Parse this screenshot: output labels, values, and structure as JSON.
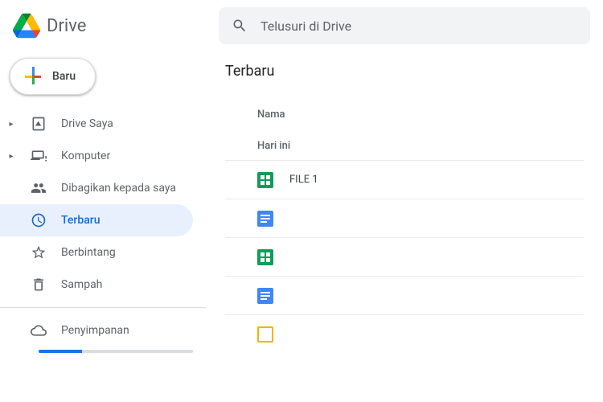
{
  "header": {
    "app_name": "Drive",
    "search_placeholder": "Telusuri di Drive"
  },
  "sidebar": {
    "new_button": "Baru",
    "items": [
      {
        "label": "Drive Saya",
        "icon": "drive",
        "expandable": true
      },
      {
        "label": "Komputer",
        "icon": "computers",
        "expandable": true
      },
      {
        "label": "Dibagikan kepada saya",
        "icon": "shared",
        "expandable": false
      },
      {
        "label": "Terbaru",
        "icon": "recent",
        "expandable": false,
        "active": true
      },
      {
        "label": "Berbintang",
        "icon": "starred",
        "expandable": false
      },
      {
        "label": "Sampah",
        "icon": "trash",
        "expandable": false
      }
    ],
    "storage_label": "Penyimpanan"
  },
  "main": {
    "title": "Terbaru",
    "column_header": "Nama",
    "section": "Hari ini",
    "files": [
      {
        "name": "FILE 1",
        "type": "sheets"
      },
      {
        "name": "",
        "type": "docs"
      },
      {
        "name": "",
        "type": "sheets"
      },
      {
        "name": "",
        "type": "docs"
      },
      {
        "name": "",
        "type": "slides"
      }
    ]
  }
}
